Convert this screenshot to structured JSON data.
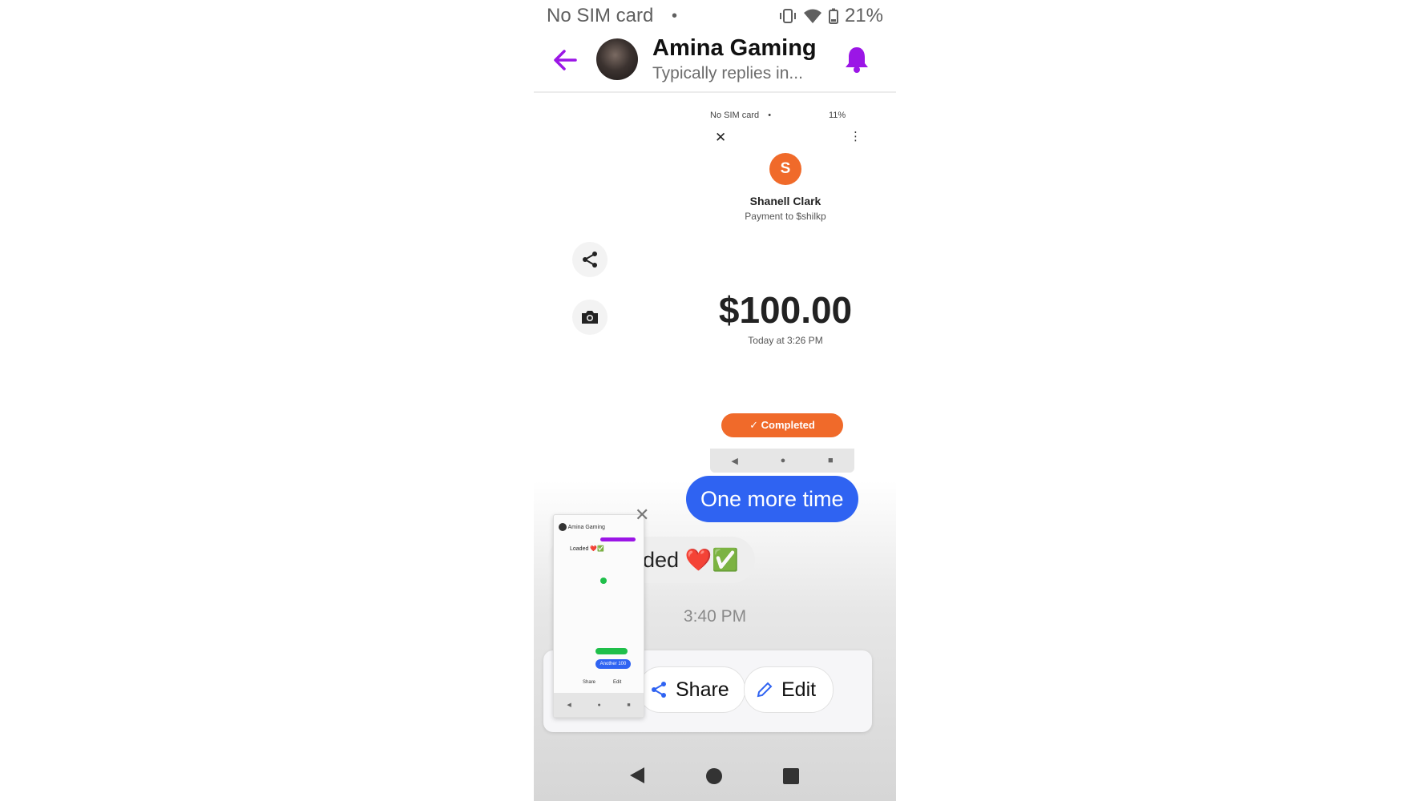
{
  "status_bar": {
    "carrier": "No SIM card",
    "dot": "•",
    "battery": "21%"
  },
  "header": {
    "name": "Amina Gaming",
    "subtitle": "Typically replies in...",
    "back_icon": "back-arrow-icon",
    "bell_icon": "bell-icon",
    "accent": "#9b16e6"
  },
  "shared_screenshot": {
    "status": {
      "carrier": "No SIM card",
      "dot": "•",
      "battery": "11%"
    },
    "close": "✕",
    "menu": "⋮",
    "avatar_letter": "S",
    "payee": "Shanell Clark",
    "payee_sub": "Payment to $shilkp",
    "amount": "$100.00",
    "amount_time": "Today at 3:26 PM",
    "completed": "✓ Completed",
    "brand_color": "#f06a2a"
  },
  "messages": {
    "outgoing": "One more time",
    "incoming": "ded ❤️✅",
    "time": "3:40 PM"
  },
  "share_sheet": {
    "share_label": "Share",
    "edit_label": "Edit",
    "thumb_name": "Amina Gaming",
    "thumb_msg": "Loaded ❤️✅",
    "thumb_pill": "Another 100",
    "thumb_share": "Share",
    "thumb_edit": "Edit"
  }
}
